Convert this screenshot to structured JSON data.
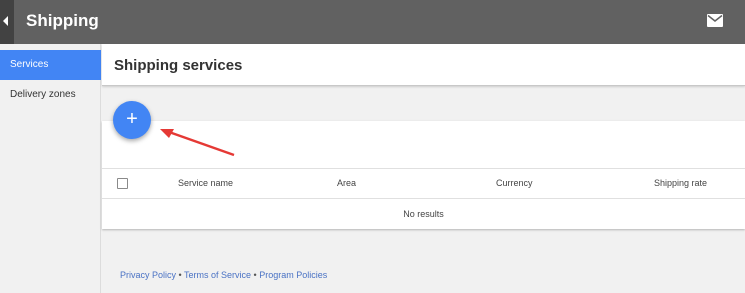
{
  "header": {
    "title": "Shipping",
    "back_icon": "chevron-left-icon",
    "mail_icon": "mail-icon"
  },
  "sidebar": {
    "items": [
      {
        "label": "Services",
        "active": true
      },
      {
        "label": "Delivery zones",
        "active": false
      }
    ]
  },
  "main": {
    "title": "Shipping services",
    "fab_label": "+",
    "table": {
      "columns": [
        "Service name",
        "Area",
        "Currency",
        "Shipping rate"
      ],
      "empty_text": "No results"
    }
  },
  "footer": {
    "privacy": "Privacy Policy",
    "separator": " • ",
    "terms": "Terms of Service",
    "program": "Program Policies"
  },
  "colors": {
    "topbar": "#616161",
    "accent": "#4285f4",
    "annotation_arrow": "#e53935"
  }
}
